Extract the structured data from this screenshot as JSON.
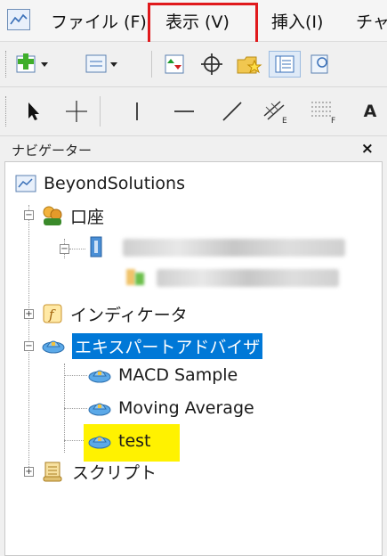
{
  "menubar": {
    "items": [
      {
        "label": "ファイル (F)"
      },
      {
        "label": "表示 (V)"
      },
      {
        "label": "挿入(I)"
      },
      {
        "label": "チャ"
      }
    ]
  },
  "toolbar2": {
    "text_tool_label": "A"
  },
  "navigator": {
    "title": "ナビゲーター",
    "close_label": "×",
    "root": {
      "label": "BeyondSolutions"
    },
    "accounts": {
      "label": "口座"
    },
    "indicators": {
      "label": "インディケータ"
    },
    "experts": {
      "label": "エキスパートアドバイザ",
      "items": [
        {
          "label": "MACD Sample"
        },
        {
          "label": "Moving Average"
        },
        {
          "label": "test"
        }
      ]
    },
    "scripts": {
      "label": "スクリプト"
    }
  },
  "colors": {
    "highlight_box": "#e0191c",
    "selection": "#0078d7",
    "marker": "#fff200"
  }
}
